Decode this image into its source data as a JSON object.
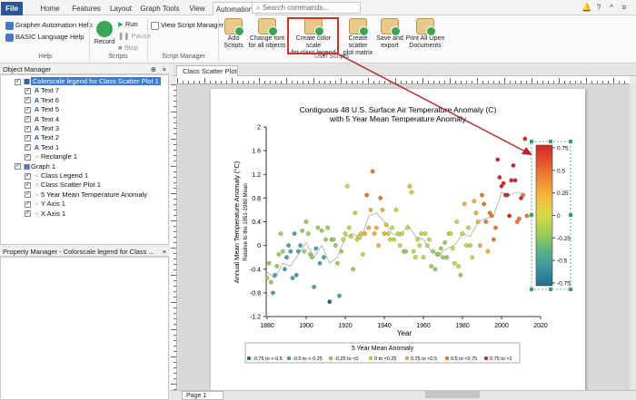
{
  "tabs": [
    {
      "label": "File",
      "x": 1,
      "w": 24
    },
    {
      "label": "Home",
      "x": 40,
      "w": 30
    },
    {
      "label": "Features",
      "x": 76,
      "w": 38
    },
    {
      "label": "Layout",
      "x": 118,
      "w": 30
    },
    {
      "label": "Graph Tools",
      "x": 152,
      "w": 48
    },
    {
      "label": "View",
      "x": 205,
      "w": 24
    },
    {
      "label": "Automation",
      "x": 234,
      "w": 48
    }
  ],
  "search_placeholder": "Search commands...",
  "ribbon": {
    "help": {
      "grapher_automation_help": "Grapher Automation Help",
      "basic_language_help": "BASIC Language Help",
      "label": "Help"
    },
    "scripts": {
      "record": "Record",
      "run": "Run",
      "pause": "Pause",
      "stop": "Stop",
      "label": "Scripts"
    },
    "script_manager": {
      "view": "View Script Manager",
      "label": "Script Manager"
    },
    "automation": {
      "buttons": [
        "Add\nScripts",
        "Change font\nfor all objects",
        "Create color scale\nfor class legend",
        "Create scatter\nplot matrix",
        "Save and\nexport",
        "Print All Open\nDocuments"
      ],
      "label": "User Scripts"
    }
  },
  "object_manager": {
    "title": "Object Manager",
    "items": [
      "Colorscale legend for Class Scatter Plot 1",
      "Text 7",
      "Text 6",
      "Text 5",
      "Text 4",
      "Text 3",
      "Text 2",
      "Text 1",
      "Rectangle 1",
      "Graph 1",
      "Class Legend 1",
      "Class Scatter Plot 1",
      "5 Year Mean Temperature Anomaly",
      "Y Axis 1",
      "X Axis 1"
    ]
  },
  "property_manager": {
    "title": "Property Manager - Colorscale legend for Class ..."
  },
  "document": {
    "tab": "Class Scatter Plot *",
    "page_tab": "Page 1"
  },
  "chart_data": {
    "type": "scatter",
    "title": "Contiguous 48 U.S. Surface Air Temperature Anomaly (C)",
    "subtitle": "with 5 Year Mean Temperature Anomaly",
    "xlabel": "Year",
    "ylabel": "Annual Mean Temperature Anomaly (°C)",
    "ylabel2": "Relative to the 1951-1980 Mean",
    "xlim": [
      1880,
      2020
    ],
    "ylim": [
      -1.2,
      2
    ],
    "xticks": [
      1880,
      1900,
      1920,
      1940,
      1960,
      1980,
      2000,
      2020
    ],
    "yticks": [
      -1.2,
      -0.8,
      -0.4,
      0,
      0.4,
      0.8,
      1.2,
      1.6,
      2
    ],
    "legend_title": "5 Year Mean Anomaly",
    "classes": [
      {
        "label": "-0.75 to <-0.5",
        "color": "#1a6a86"
      },
      {
        "label": "-0.5 to <-0.25",
        "color": "#4aa3a6"
      },
      {
        "label": "-0.25 to <0",
        "color": "#9ccf63"
      },
      {
        "label": "0 to <0.25",
        "color": "#c7d94a"
      },
      {
        "label": "0.25 to <0.5",
        "color": "#f0b43a"
      },
      {
        "label": "0.5 to <0.75",
        "color": "#ea7a2c"
      },
      {
        "label": "0.75 to <1",
        "color": "#d0262b"
      }
    ],
    "colorscale_ticks": [
      "0.75",
      "0.5",
      "0.25",
      "0",
      "-0.25",
      "-0.5",
      "-0.75"
    ],
    "colorscale_colors": [
      "#d0262b",
      "#e4572a",
      "#f08c30",
      "#f3bd3c",
      "#d8d844",
      "#9ecd55",
      "#5bb283",
      "#3b94a0",
      "#21708f"
    ],
    "points": [
      [
        1880,
        -0.55,
        2
      ],
      [
        1881,
        -0.3,
        2
      ],
      [
        1882,
        -0.62,
        2
      ],
      [
        1883,
        -0.8,
        1
      ],
      [
        1884,
        -0.5,
        1
      ],
      [
        1885,
        -0.35,
        2
      ],
      [
        1886,
        -0.15,
        2
      ],
      [
        1887,
        0.2,
        2
      ],
      [
        1888,
        -0.1,
        2
      ],
      [
        1889,
        -0.4,
        1
      ],
      [
        1890,
        -0.2,
        1
      ],
      [
        1891,
        0.0,
        1
      ],
      [
        1892,
        -0.1,
        1
      ],
      [
        1893,
        -0.55,
        1
      ],
      [
        1894,
        0.2,
        1
      ],
      [
        1895,
        -0.5,
        1
      ],
      [
        1896,
        -0.1,
        1
      ],
      [
        1897,
        0.0,
        1
      ],
      [
        1898,
        0.25,
        2
      ],
      [
        1899,
        -0.1,
        2
      ],
      [
        1900,
        0.4,
        2
      ],
      [
        1901,
        0.2,
        2
      ],
      [
        1902,
        -0.15,
        2
      ],
      [
        1903,
        -0.2,
        2
      ],
      [
        1904,
        -0.7,
        1
      ],
      [
        1905,
        -0.05,
        1
      ],
      [
        1906,
        0.3,
        2
      ],
      [
        1907,
        -0.3,
        1
      ],
      [
        1908,
        0.25,
        2
      ],
      [
        1909,
        -0.2,
        1
      ],
      [
        1910,
        0.1,
        2
      ],
      [
        1911,
        0.3,
        2
      ],
      [
        1912,
        -0.95,
        0
      ],
      [
        1913,
        0.1,
        2
      ],
      [
        1914,
        0.1,
        2
      ],
      [
        1915,
        0.0,
        2
      ],
      [
        1916,
        -0.3,
        2
      ],
      [
        1917,
        -0.85,
        1
      ],
      [
        1918,
        -0.1,
        2
      ],
      [
        1919,
        0.1,
        3
      ],
      [
        1920,
        0.2,
        3
      ],
      [
        1921,
        1.0,
        3
      ],
      [
        1922,
        0.3,
        3
      ],
      [
        1923,
        0.15,
        3
      ],
      [
        1924,
        -0.4,
        2
      ],
      [
        1925,
        0.55,
        3
      ],
      [
        1926,
        0.1,
        3
      ],
      [
        1927,
        0.15,
        3
      ],
      [
        1928,
        0.2,
        3
      ],
      [
        1929,
        -0.15,
        3
      ],
      [
        1930,
        0.2,
        4
      ],
      [
        1931,
        0.85,
        5
      ],
      [
        1932,
        0.3,
        4
      ],
      [
        1933,
        0.6,
        4
      ],
      [
        1934,
        1.25,
        5
      ],
      [
        1935,
        0.2,
        4
      ],
      [
        1936,
        0.3,
        4
      ],
      [
        1937,
        0.0,
        4
      ],
      [
        1938,
        0.8,
        5
      ],
      [
        1939,
        0.6,
        4
      ],
      [
        1940,
        0.2,
        4
      ],
      [
        1941,
        0.35,
        4
      ],
      [
        1942,
        0.2,
        3
      ],
      [
        1943,
        0.1,
        3
      ],
      [
        1944,
        0.3,
        3
      ],
      [
        1945,
        0.1,
        3
      ],
      [
        1946,
        0.6,
        3
      ],
      [
        1947,
        0.2,
        3
      ],
      [
        1948,
        0.0,
        3
      ],
      [
        1949,
        0.2,
        3
      ],
      [
        1950,
        -0.1,
        2
      ],
      [
        1951,
        -0.1,
        2
      ],
      [
        1952,
        0.3,
        3
      ],
      [
        1953,
        1.0,
        4
      ],
      [
        1954,
        0.9,
        3
      ],
      [
        1955,
        -0.1,
        3
      ],
      [
        1956,
        -0.2,
        3
      ],
      [
        1957,
        0.1,
        3
      ],
      [
        1958,
        0.0,
        3
      ],
      [
        1959,
        0.2,
        3
      ],
      [
        1960,
        -0.2,
        3
      ],
      [
        1961,
        0.2,
        3
      ],
      [
        1962,
        0.0,
        3
      ],
      [
        1963,
        0.1,
        3
      ],
      [
        1964,
        -0.35,
        2
      ],
      [
        1965,
        -0.1,
        2
      ],
      [
        1966,
        -0.4,
        2
      ],
      [
        1967,
        -0.15,
        2
      ],
      [
        1968,
        -0.15,
        2
      ],
      [
        1969,
        -0.05,
        2
      ],
      [
        1970,
        -0.2,
        2
      ],
      [
        1971,
        0.05,
        2
      ],
      [
        1972,
        -0.2,
        2
      ],
      [
        1973,
        0.2,
        3
      ],
      [
        1974,
        0.2,
        3
      ],
      [
        1975,
        -0.05,
        3
      ],
      [
        1976,
        -0.3,
        3
      ],
      [
        1977,
        0.4,
        3
      ],
      [
        1978,
        -0.35,
        3
      ],
      [
        1979,
        -0.5,
        2
      ],
      [
        1980,
        0.2,
        3
      ],
      [
        1981,
        0.7,
        4
      ],
      [
        1982,
        0.0,
        3
      ],
      [
        1983,
        0.3,
        3
      ],
      [
        1984,
        0.0,
        3
      ],
      [
        1985,
        -0.2,
        3
      ],
      [
        1986,
        0.75,
        4
      ],
      [
        1987,
        0.55,
        4
      ],
      [
        1988,
        0.4,
        4
      ],
      [
        1989,
        0.0,
        4
      ],
      [
        1990,
        0.85,
        5
      ],
      [
        1991,
        0.7,
        5
      ],
      [
        1992,
        0.4,
        5
      ],
      [
        1993,
        -0.1,
        4
      ],
      [
        1994,
        0.55,
        5
      ],
      [
        1995,
        0.5,
        5
      ],
      [
        1996,
        0.1,
        5
      ],
      [
        1997,
        0.3,
        5
      ],
      [
        1998,
        1.45,
        6
      ],
      [
        1999,
        1.15,
        6
      ],
      [
        2000,
        1.0,
        6
      ],
      [
        2001,
        1.05,
        6
      ],
      [
        2002,
        0.85,
        6
      ],
      [
        2003,
        0.85,
        6
      ],
      [
        2004,
        0.5,
        6
      ],
      [
        2005,
        1.1,
        6
      ],
      [
        2006,
        1.35,
        6
      ],
      [
        2007,
        1.1,
        6
      ],
      [
        2008,
        0.4,
        5
      ],
      [
        2009,
        0.45,
        5
      ],
      [
        2010,
        0.8,
        6
      ],
      [
        2011,
        0.85,
        5
      ],
      [
        2012,
        1.8,
        6
      ],
      [
        2013,
        0.5,
        5
      ]
    ],
    "mean_line": [
      [
        1880,
        -0.45
      ],
      [
        1884,
        -0.55
      ],
      [
        1888,
        -0.3
      ],
      [
        1892,
        -0.35
      ],
      [
        1896,
        -0.15
      ],
      [
        1900,
        0.05
      ],
      [
        1904,
        -0.2
      ],
      [
        1908,
        0.0
      ],
      [
        1912,
        -0.3
      ],
      [
        1916,
        -0.2
      ],
      [
        1920,
        0.15
      ],
      [
        1924,
        0.2
      ],
      [
        1928,
        0.1
      ],
      [
        1932,
        0.5
      ],
      [
        1936,
        0.55
      ],
      [
        1940,
        0.4
      ],
      [
        1944,
        0.2
      ],
      [
        1948,
        0.15
      ],
      [
        1952,
        0.35
      ],
      [
        1956,
        0.15
      ],
      [
        1960,
        0.1
      ],
      [
        1964,
        -0.1
      ],
      [
        1968,
        -0.15
      ],
      [
        1972,
        -0.05
      ],
      [
        1976,
        0.0
      ],
      [
        1980,
        0.2
      ],
      [
        1984,
        0.15
      ],
      [
        1988,
        0.4
      ],
      [
        1992,
        0.45
      ],
      [
        1996,
        0.5
      ],
      [
        2000,
        0.9
      ],
      [
        2004,
        0.85
      ],
      [
        2008,
        0.9
      ],
      [
        2012,
        0.85
      ]
    ]
  }
}
